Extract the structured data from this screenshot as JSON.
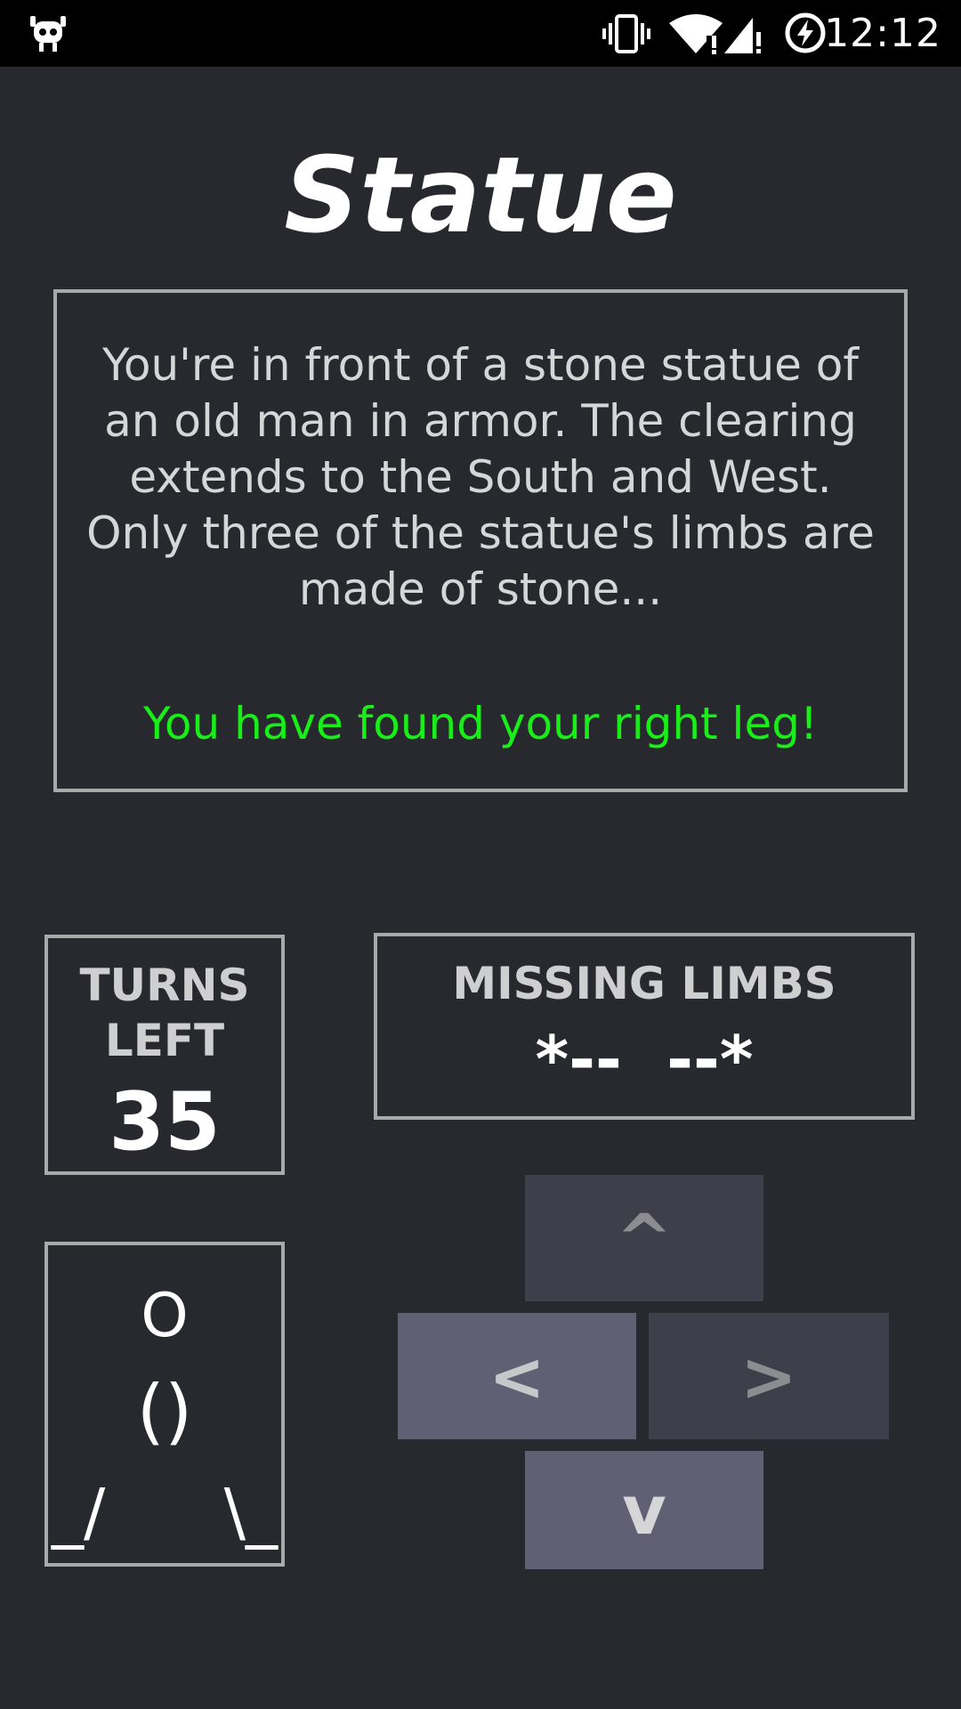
{
  "status_bar": {
    "time": "12:12",
    "icons": [
      "cyanogenmod-icon",
      "vibrate-icon",
      "wifi-icon",
      "signal-icon",
      "battery-saver-icon"
    ]
  },
  "title": "Statue",
  "description": "You're in front of a stone statue of an old man in armor. The clearing extends to the South and West. Only three of the statue's limbs are made of stone...",
  "found_message": "You have found your right leg!",
  "turns": {
    "label": "TURNS LEFT",
    "value": "35"
  },
  "missing_limbs": {
    "label": "MISSING LIMBS",
    "value": "*--  --*"
  },
  "figure": {
    "head": "O",
    "body": "()",
    "left_leg": "_/",
    "right_leg": "\\_"
  },
  "controls": {
    "up": "^",
    "left": "<",
    "right": ">",
    "down": "v"
  },
  "colors": {
    "background": "#28292e",
    "border": "#a9a9ab",
    "found_text": "#19ee19",
    "button_dim": "#3f3e4b",
    "button_active": "#615f74"
  }
}
